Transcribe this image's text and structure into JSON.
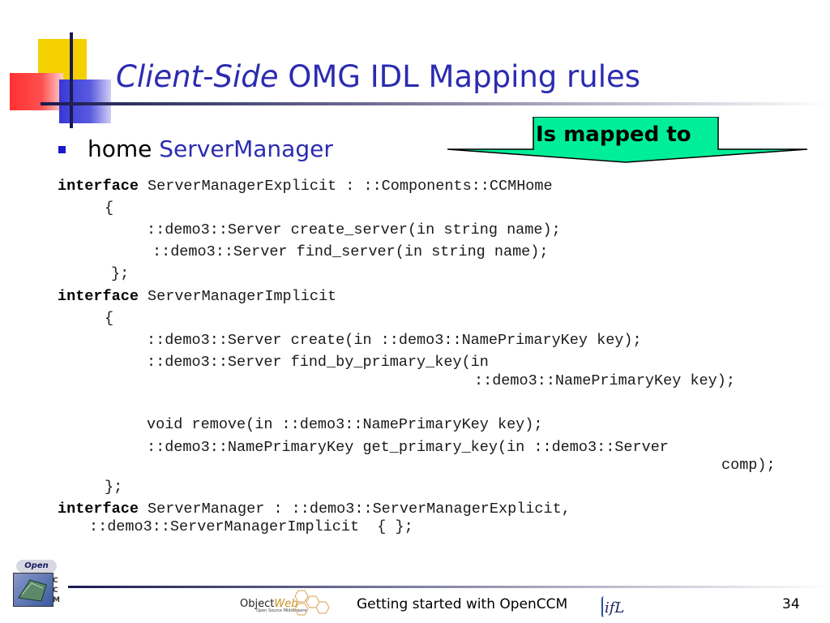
{
  "slide": {
    "title_italic": "Client-Side",
    "title_rest": " OMG IDL Mapping rules",
    "bullet": {
      "prefix": "home ",
      "highlight": "ServerManager"
    },
    "callout": "Is mapped to",
    "code": {
      "l1_kw": "interface",
      "l1": " ServerManagerExplicit : ::Components::CCMHome",
      "l2": "{",
      "l3": "::demo3::Server create_server(in string name);",
      "l4": "::demo3::Server find_server(in string name);",
      "l5": "};",
      "l6_kw": "interface",
      "l6": " ServerManagerImplicit",
      "l7": "{",
      "l8": "::demo3::Server create(in ::demo3::NamePrimaryKey key);",
      "l9": "::demo3::Server find_by_primary_key(in",
      "l10": "::demo3::NamePrimaryKey key);",
      "l11": "void remove(in ::demo3::NamePrimaryKey key);",
      "l12": "::demo3::NamePrimaryKey get_primary_key(in ::demo3::Server",
      "l13": "comp);",
      "l14": "};",
      "l15_kw": "interface",
      "l15": " ServerManager : ::demo3::ServerManagerExplicit,",
      "l16": "::demo3::ServerManagerImplicit  { };"
    },
    "footer": {
      "logo_open": "Open",
      "logo_letters": "CCM",
      "objectweb_a": "Object",
      "objectweb_b": "Web",
      "objectweb_sub": "Open Source Middleware",
      "center_text": "Getting started with OpenCCM",
      "ifl": "ifL",
      "page_number": "34"
    }
  },
  "colors": {
    "title_blue": "#2b2bb0",
    "callout_fill": "#00ee99",
    "accent_yellow": "#f5d000",
    "accent_red": "#ff3030"
  },
  "icons": [
    "opencc-logo-icon",
    "objectweb-logo-icon",
    "ifl-logo-icon",
    "bullet-square-icon"
  ]
}
